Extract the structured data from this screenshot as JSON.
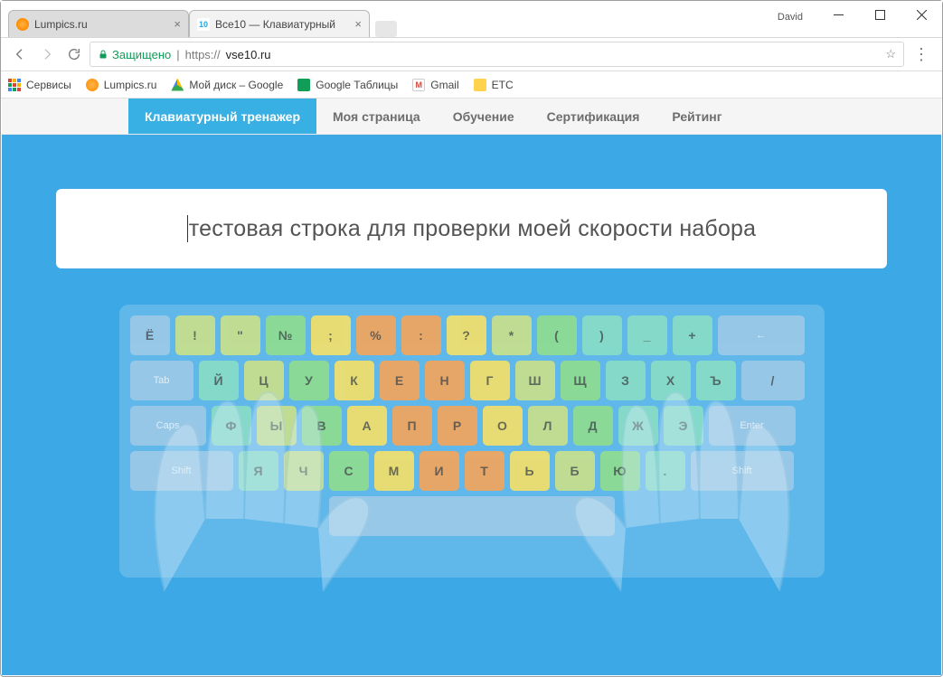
{
  "browser": {
    "profile": "David",
    "tabs": [
      {
        "title": "Lumpics.ru"
      },
      {
        "title": "Все10 — Клавиатурный"
      }
    ],
    "secure_label": "Защищено",
    "url": {
      "scheme": "https://",
      "host": "vse10.ru"
    },
    "bookmarks": [
      "Сервисы",
      "Lumpics.ru",
      "Мой диск – Google",
      "Google Таблицы",
      "Gmail",
      "ETC"
    ]
  },
  "page": {
    "nav": [
      "Клавиатурный тренажер",
      "Моя страница",
      "Обучение",
      "Сертификация",
      "Рейтинг"
    ],
    "typing_text": "тестовая строка для проверки моей скорости набора"
  },
  "kb": {
    "r1": [
      "Ё",
      "!",
      "\"",
      "№",
      ";",
      "%",
      ":",
      "?",
      "*",
      "(",
      ")",
      "_",
      "+",
      "←"
    ],
    "r2": [
      "Tab",
      "Й",
      "Ц",
      "У",
      "К",
      "Е",
      "Н",
      "Г",
      "Ш",
      "Щ",
      "З",
      "Х",
      "Ъ",
      "/"
    ],
    "r3": [
      "Caps",
      "Ф",
      "Ы",
      "В",
      "А",
      "П",
      "Р",
      "О",
      "Л",
      "Д",
      "Ж",
      "Э",
      "Enter"
    ],
    "r4": [
      "Shift",
      "Я",
      "Ч",
      "С",
      "М",
      "И",
      "Т",
      "Ь",
      "Б",
      "Ю",
      ".",
      "Shift"
    ]
  }
}
